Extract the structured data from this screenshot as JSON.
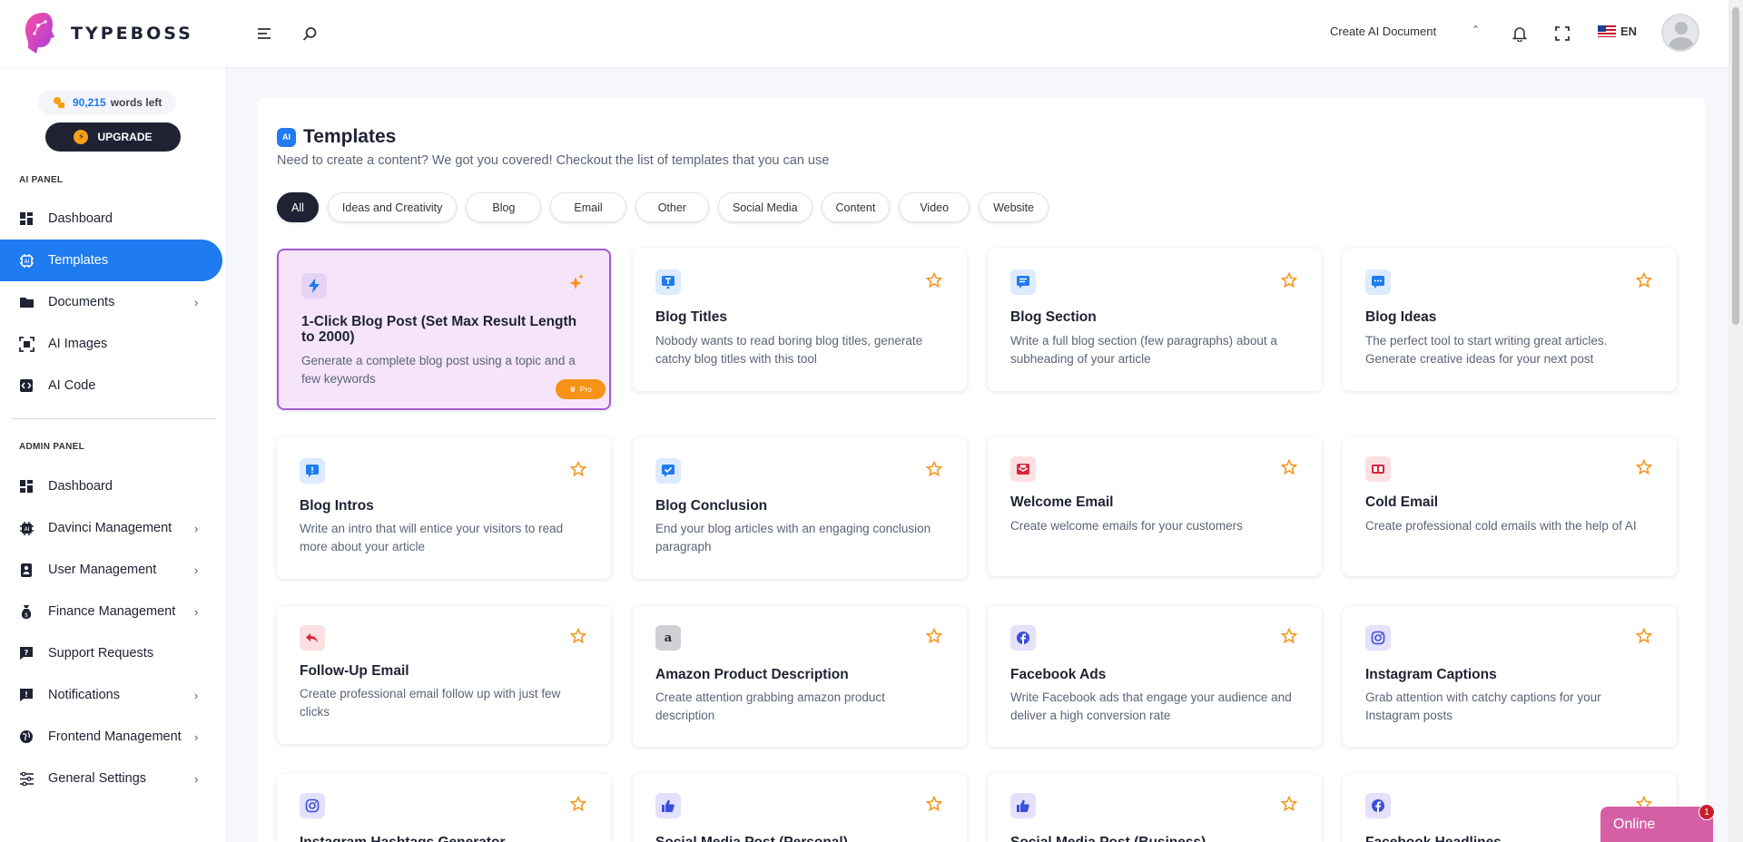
{
  "brand": {
    "name": "TYPEBOSS"
  },
  "header": {
    "create_doc": "Create AI Document",
    "language": "EN"
  },
  "sidebar": {
    "words_count": "90,215",
    "words_label": "words left",
    "upgrade_label": "UPGRADE",
    "ai_panel_label": "AI PANEL",
    "admin_panel_label": "ADMIN PANEL",
    "ai_items": [
      {
        "label": "Dashboard",
        "icon": "dashboard-icon"
      },
      {
        "label": "Templates",
        "icon": "templates-icon"
      },
      {
        "label": "Documents",
        "icon": "folder-icon"
      },
      {
        "label": "AI Images",
        "icon": "image-icon"
      },
      {
        "label": "AI Code",
        "icon": "code-icon"
      }
    ],
    "admin_items": [
      {
        "label": "Dashboard",
        "icon": "dashboard-icon"
      },
      {
        "label": "Davinci Management",
        "icon": "chip-icon"
      },
      {
        "label": "User Management",
        "icon": "user-icon"
      },
      {
        "label": "Finance Management",
        "icon": "money-bag-icon"
      },
      {
        "label": "Support Requests",
        "icon": "question-icon"
      },
      {
        "label": "Notifications",
        "icon": "alert-icon"
      },
      {
        "label": "Frontend Management",
        "icon": "globe-icon"
      },
      {
        "label": "General Settings",
        "icon": "sliders-icon"
      }
    ]
  },
  "main": {
    "title_badge": "AI",
    "title": "Templates",
    "subtitle": "Need to create a content? We got you covered! Checkout the list of templates that you can use",
    "filters": [
      "All",
      "Ideas and Creativity",
      "Blog",
      "Email",
      "Other",
      "Social Media",
      "Content",
      "Video",
      "Website"
    ],
    "cards": [
      {
        "title": "1-Click Blog Post (Set Max Result Length to 2000)",
        "desc": "Generate a complete blog post using a topic and a few keywords",
        "badge": "Pro"
      },
      {
        "title": "Blog Titles",
        "desc": "Nobody wants to read boring blog titles, generate catchy blog titles with this tool"
      },
      {
        "title": "Blog Section",
        "desc": "Write a full blog section (few paragraphs) about a subheading of your article"
      },
      {
        "title": "Blog Ideas",
        "desc": "The perfect tool to start writing great articles. Generate creative ideas for your next post"
      },
      {
        "title": "Blog Intros",
        "desc": "Write an intro that will entice your visitors to read more about your article"
      },
      {
        "title": "Blog Conclusion",
        "desc": "End your blog articles with an engaging conclusion paragraph"
      },
      {
        "title": "Welcome Email",
        "desc": "Create welcome emails for your customers"
      },
      {
        "title": "Cold Email",
        "desc": "Create professional cold emails with the help of AI"
      },
      {
        "title": "Follow-Up Email",
        "desc": "Create professional email follow up with just few clicks"
      },
      {
        "title": "Amazon Product Description",
        "desc": "Create attention grabbing amazon product description"
      },
      {
        "title": "Facebook Ads",
        "desc": "Write Facebook ads that engage your audience and deliver a high conversion rate"
      },
      {
        "title": "Instagram Captions",
        "desc": "Grab attention with catchy captions for your Instagram posts"
      },
      {
        "title": "Instagram Hashtags Generator",
        "desc": ""
      },
      {
        "title": "Social Media Post (Personal)",
        "desc": ""
      },
      {
        "title": "Social Media Post (Business)",
        "desc": ""
      },
      {
        "title": "Facebook Headlines",
        "desc": ""
      }
    ]
  },
  "chat": {
    "label": "Online",
    "count": "1"
  },
  "colors": {
    "accent": "#1e7bf0",
    "dark": "#1e2233",
    "star": "#f69317",
    "featured_bg": "#f6e4fb",
    "featured_border": "#a45bd6"
  }
}
